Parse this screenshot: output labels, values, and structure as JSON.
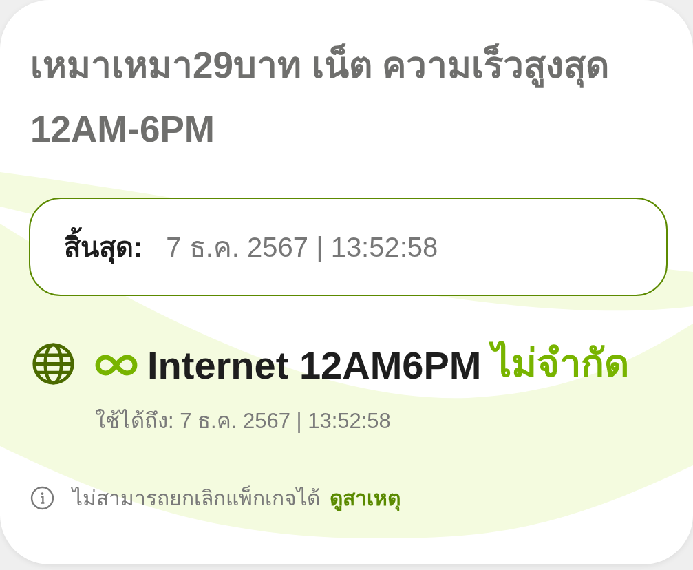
{
  "package": {
    "title": "เหมาเหมา29บาท เน็ต ความเร็วสูงสุด 12AM-6PM"
  },
  "expiry": {
    "label": "สิ้นสุด:",
    "value": "7 ธ.ค. 2567 | 13:52:58"
  },
  "benefits": [
    {
      "name": "Internet 12AM6PM",
      "quota": "ไม่จำกัด",
      "valid_until": "ใช้ได้ถึง: 7 ธ.ค. 2567 | 13:52:58"
    }
  ],
  "notice": {
    "text": "ไม่สามารถยกเลิกแพ็กเกจได้",
    "link": "ดูสาเหตุ"
  }
}
